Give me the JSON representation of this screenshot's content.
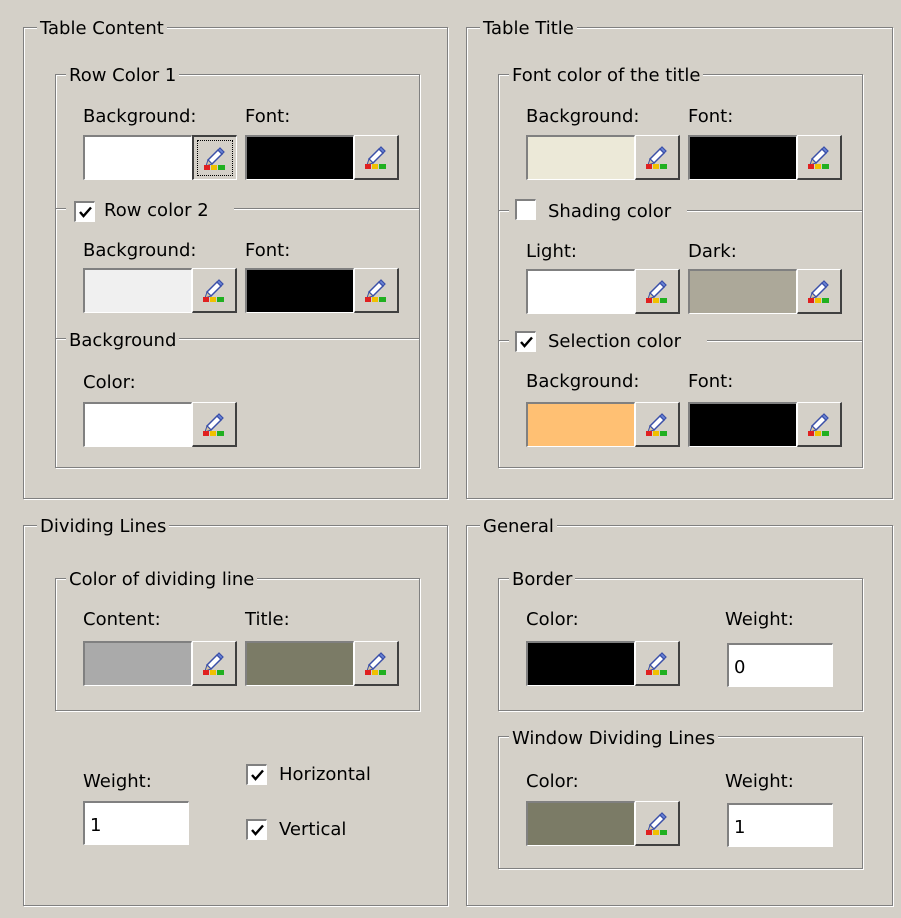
{
  "table_content": {
    "title": "Table Content",
    "row_color_1": {
      "title": "Row Color 1",
      "background_label": "Background:",
      "font_label": "Font:",
      "background_color": "#ffffff",
      "font_color": "#000000"
    },
    "row_color_2": {
      "title": "Row color 2",
      "checked": true,
      "background_label": "Background:",
      "font_label": "Font:",
      "background_color": "#f0f0f0",
      "font_color": "#000000"
    },
    "background": {
      "title": "Background",
      "color_label": "Color:",
      "color": "#ffffff"
    }
  },
  "table_title": {
    "title": "Table Title",
    "font_color": {
      "title": "Font color of the title",
      "background_label": "Background:",
      "font_label": "Font:",
      "background_color": "#ece9d8",
      "font_color": "#000000"
    },
    "shading_color": {
      "title": "Shading color",
      "checked": false,
      "light_label": "Light:",
      "dark_label": "Dark:",
      "light_color": "#ffffff",
      "dark_color": "#aca899"
    },
    "selection_color": {
      "title": "Selection color",
      "checked": true,
      "background_label": "Background:",
      "font_label": "Font:",
      "background_color": "#ffc073",
      "font_color": "#000000"
    }
  },
  "dividing_lines": {
    "title": "Dividing Lines",
    "color": {
      "title": "Color of dividing line",
      "content_label": "Content:",
      "title_label": "Title:",
      "content_color": "#aaaaaa",
      "title_color": "#7b7b66"
    },
    "weight_label": "Weight:",
    "weight_value": "1",
    "horizontal_label": "Horizontal",
    "horizontal_checked": true,
    "vertical_label": "Vertical",
    "vertical_checked": true
  },
  "general": {
    "title": "General",
    "border": {
      "title": "Border",
      "color_label": "Color:",
      "weight_label": "Weight:",
      "color": "#000000",
      "weight_value": "0"
    },
    "window_dividing": {
      "title": "Window Dividing Lines",
      "color_label": "Color:",
      "weight_label": "Weight:",
      "color": "#7b7b66",
      "weight_value": "1"
    }
  },
  "icons": {
    "picker": "color-picker-icon",
    "check": "check-mark-icon"
  }
}
